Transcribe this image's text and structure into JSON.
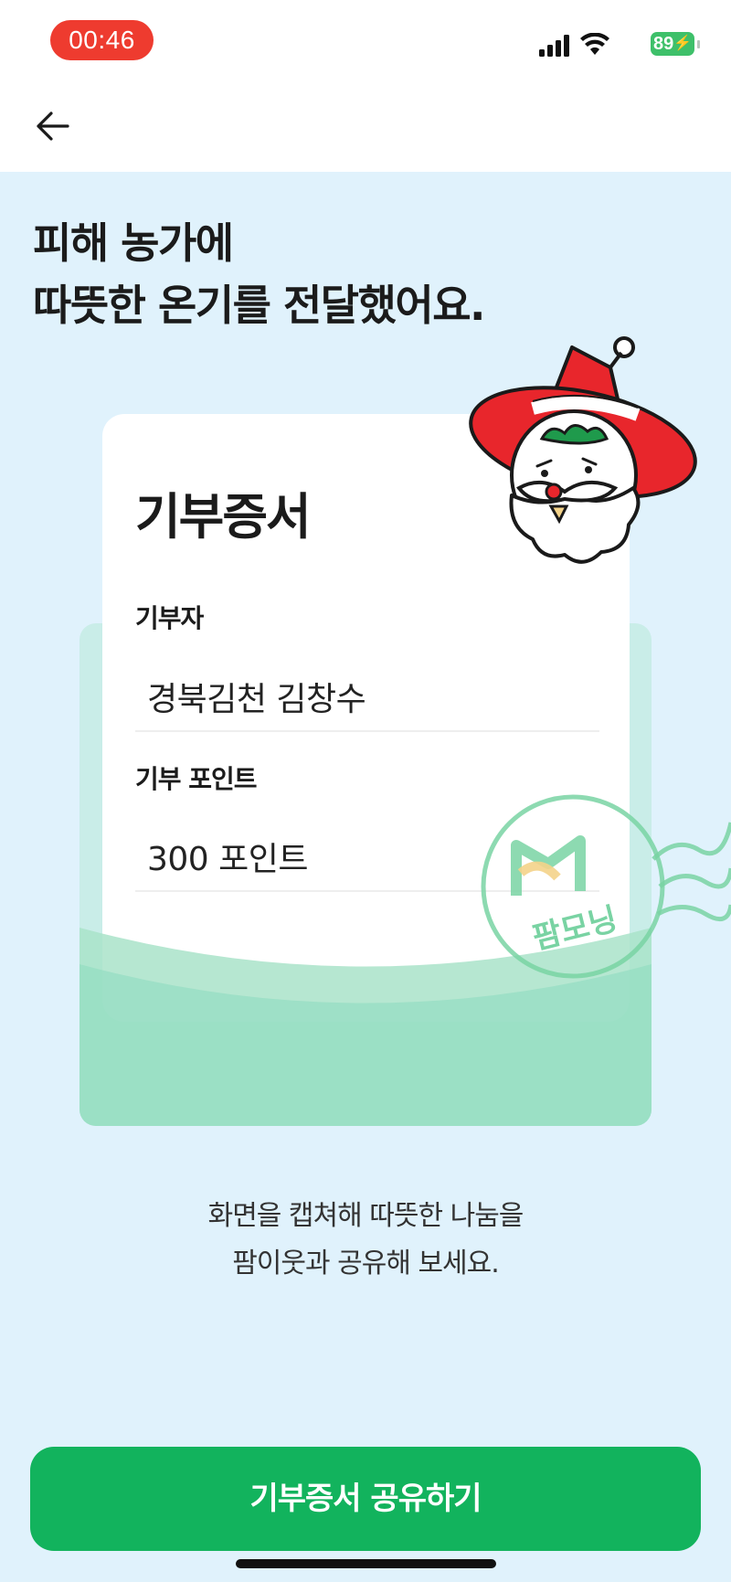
{
  "status_bar": {
    "time": "00:46",
    "battery": "89",
    "icons": [
      "signal-icon",
      "wifi-icon",
      "battery-icon"
    ]
  },
  "nav": {
    "back_icon": "arrow-left-icon"
  },
  "headline": {
    "line1": "피해 농가에",
    "line2": "따뜻한 온기를 전달했어요."
  },
  "certificate": {
    "title": "기부증서",
    "donor_label": "기부자",
    "donor_value": "경북김천 김창수",
    "points_label": "기부 포인트",
    "points_value": "300 포인트",
    "stamp_text": "팜모닝"
  },
  "share_hint": {
    "line1": "화면을 캡쳐해 따뜻한 나눔을",
    "line2": "팜이웃과 공유해 보세요."
  },
  "share_button_label": "기부증서 공유하기",
  "colors": {
    "background": "#e0f2fc",
    "primary_green": "#12b35d",
    "envelope": "#c9ede8",
    "time_pill": "#ee3b2f"
  }
}
